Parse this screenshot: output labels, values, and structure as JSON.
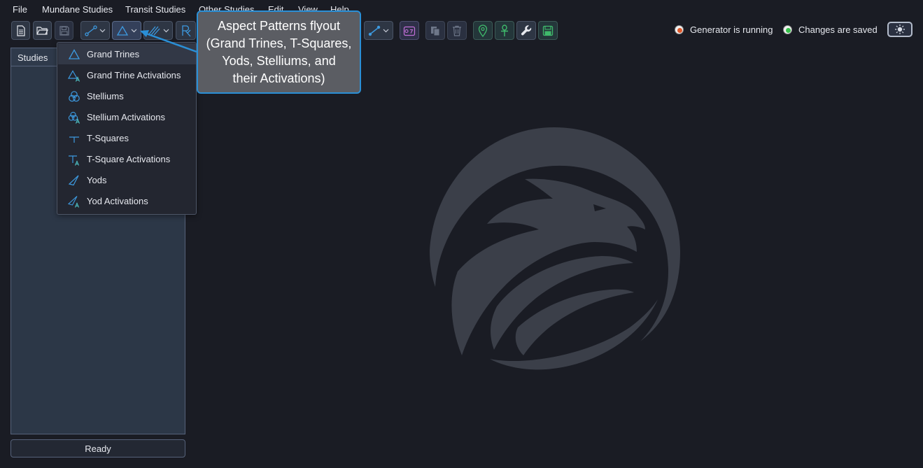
{
  "menubar": {
    "items": [
      "File",
      "Mundane Studies",
      "Transit Studies",
      "Other Studies",
      "Edit",
      "View",
      "Help"
    ]
  },
  "status": {
    "generator": "Generator is running",
    "saved": "Changes are saved"
  },
  "studies": {
    "header": "Studies",
    "ready": "Ready"
  },
  "flyout": {
    "items": [
      {
        "label": "Grand Trines",
        "icon": "triangle-icon"
      },
      {
        "label": "Grand Trine Activations",
        "icon": "triangle-activation-icon"
      },
      {
        "label": "Stelliums",
        "icon": "stellium-icon"
      },
      {
        "label": "Stellium Activations",
        "icon": "stellium-activation-icon"
      },
      {
        "label": "T-Squares",
        "icon": "t-square-icon"
      },
      {
        "label": "T-Square Activations",
        "icon": "t-square-activation-icon"
      },
      {
        "label": "Yods",
        "icon": "yod-icon"
      },
      {
        "label": "Yod Activations",
        "icon": "yod-activation-icon"
      }
    ]
  },
  "callout": {
    "lines": [
      "Aspect Patterns flyout",
      "(Grand Trines, T-Squares,",
      "Yods, Stelliums, and",
      "their Activations)"
    ]
  },
  "colors": {
    "accent": "#2a8fd6",
    "icon_blue": "#3d9ae0",
    "icon_teal": "#4fc3c7",
    "generator_dot": "#e0582a",
    "saved_dot": "#35c24a",
    "logo": "#3b3f49"
  }
}
